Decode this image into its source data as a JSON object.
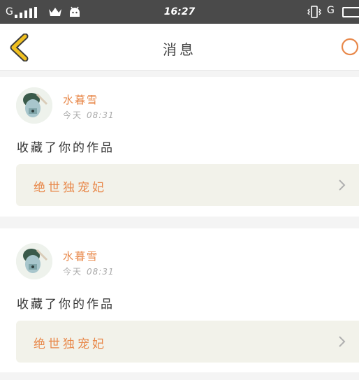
{
  "status_bar": {
    "carrier": "G",
    "time": "16:27",
    "carrier2": "G",
    "icons": [
      "signal-icon",
      "crown-icon",
      "android-icon",
      "vibrate-icon",
      "battery-icon"
    ]
  },
  "header": {
    "title": "消息",
    "back_icon": "chevron-left-icon",
    "search_icon": "search-icon",
    "accent_color": "#f0c020"
  },
  "messages": [
    {
      "user": "水暮雪",
      "day": "今天",
      "time": "08:31",
      "action": "收藏了你的作品",
      "work_title": "绝世独宠妃"
    },
    {
      "user": "水暮雪",
      "day": "今天",
      "time": "08:31",
      "action": "收藏了你的作品",
      "work_title": "绝世独宠妃"
    }
  ],
  "colors": {
    "highlight": "#e8884a",
    "work_bg": "#f2f2ea"
  }
}
